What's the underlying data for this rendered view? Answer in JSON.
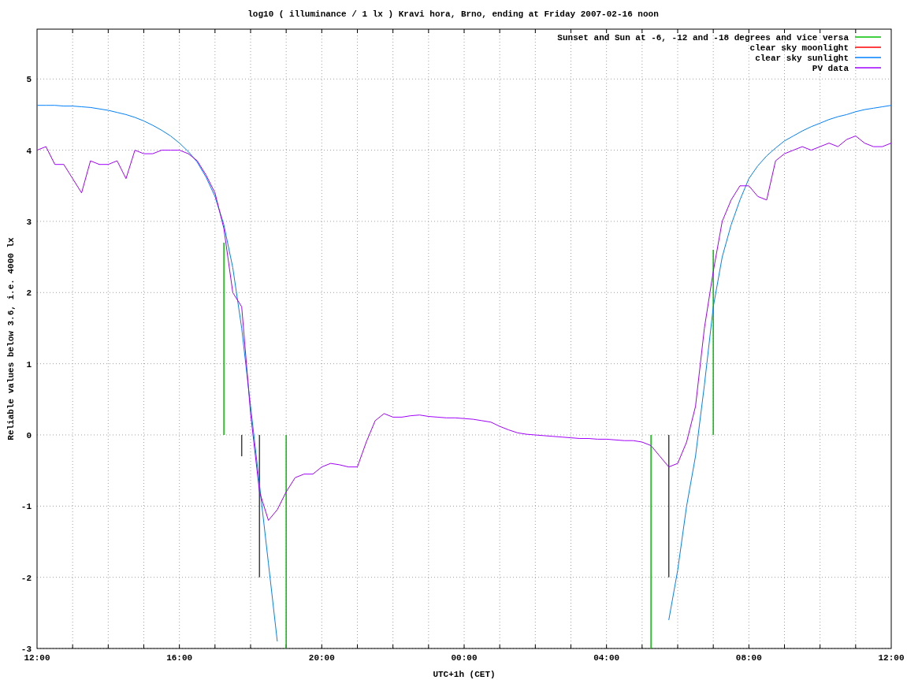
{
  "chart_data": {
    "type": "line",
    "title": "log10 ( illuminance / 1 lx ) Kravi hora, Brno, ending at Friday 2007-02-16 noon",
    "xlabel": "UTC+1h (CET)",
    "ylabel": "Reliable values below 3.6, i.e. 4000 lx",
    "ylim": [
      -3,
      5.7
    ],
    "yticks": [
      -3,
      -2,
      -1,
      0,
      1,
      2,
      3,
      4,
      5
    ],
    "categories": [
      "12:00",
      null,
      null,
      null,
      null,
      null,
      null,
      null,
      null,
      null,
      null,
      null,
      null,
      null,
      null,
      null,
      "16:00",
      null,
      null,
      null,
      null,
      null,
      null,
      null,
      null,
      null,
      null,
      null,
      null,
      null,
      null,
      null,
      "20:00",
      null,
      null,
      null,
      null,
      null,
      null,
      null,
      null,
      null,
      null,
      null,
      null,
      null,
      null,
      null,
      "00:00",
      null,
      null,
      null,
      null,
      null,
      null,
      null,
      null,
      null,
      null,
      null,
      null,
      null,
      null,
      null,
      "04:00",
      null,
      null,
      null,
      null,
      null,
      null,
      null,
      null,
      null,
      null,
      null,
      null,
      null,
      null,
      null,
      "08:00",
      null,
      null,
      null,
      null,
      null,
      null,
      null,
      null,
      null,
      null,
      null,
      null,
      null,
      null,
      null,
      "12:00"
    ],
    "series": [
      {
        "name": "Sunset and Sun at -6, -12 and -18 degrees and vice versa",
        "color": "#00c000",
        "type": "bar",
        "values": [
          null,
          null,
          null,
          null,
          null,
          null,
          null,
          null,
          null,
          null,
          null,
          null,
          null,
          null,
          null,
          null,
          null,
          null,
          null,
          null,
          null,
          2.7,
          null,
          null,
          null,
          null,
          null,
          null,
          -3,
          null,
          null,
          null,
          null,
          null,
          null,
          null,
          null,
          null,
          null,
          null,
          null,
          null,
          null,
          null,
          null,
          null,
          null,
          null,
          null,
          null,
          null,
          null,
          null,
          null,
          null,
          null,
          null,
          null,
          null,
          null,
          null,
          null,
          null,
          null,
          null,
          null,
          null,
          null,
          null,
          -3,
          null,
          null,
          null,
          null,
          null,
          null,
          2.6,
          null,
          null,
          null,
          null,
          null,
          null,
          null,
          null,
          null,
          null,
          null,
          null,
          null,
          null,
          null,
          null,
          null,
          null,
          null,
          null
        ]
      },
      {
        "name": "clear sky moonlight",
        "color": "#ff0000",
        "values": [
          null,
          null,
          null,
          null,
          null,
          null,
          null,
          null,
          null,
          null,
          null,
          null,
          null,
          null,
          null,
          null,
          null,
          null,
          null,
          null,
          null,
          null,
          null,
          null,
          null,
          null,
          null,
          null,
          null,
          null,
          null,
          null,
          null,
          null,
          null,
          null,
          null,
          null,
          null,
          null,
          null,
          null,
          null,
          null,
          null,
          null,
          null,
          null,
          null,
          null,
          null,
          null,
          null,
          null,
          null,
          null,
          null,
          null,
          null,
          null,
          null,
          null,
          null,
          null,
          null,
          null,
          null,
          null,
          null,
          null,
          null,
          null,
          null,
          null,
          null,
          null,
          null,
          null,
          null,
          null,
          null,
          null,
          null,
          null,
          null,
          null,
          null,
          null,
          null,
          null,
          null,
          null,
          null,
          null,
          null,
          null,
          null
        ]
      },
      {
        "name": "clear sky sunlight",
        "color": "#0080ff",
        "values": [
          4.63,
          4.63,
          4.63,
          4.62,
          4.62,
          4.61,
          4.6,
          4.58,
          4.56,
          4.53,
          4.5,
          4.46,
          4.41,
          4.35,
          4.28,
          4.2,
          4.1,
          3.98,
          3.83,
          3.62,
          3.35,
          2.95,
          2.35,
          1.5,
          0.4,
          -0.7,
          -1.8,
          -2.9,
          null,
          null,
          null,
          null,
          null,
          null,
          null,
          null,
          null,
          null,
          null,
          null,
          null,
          null,
          null,
          null,
          null,
          null,
          null,
          null,
          null,
          null,
          null,
          null,
          null,
          null,
          null,
          null,
          null,
          null,
          null,
          null,
          null,
          null,
          null,
          null,
          null,
          null,
          null,
          null,
          null,
          null,
          null,
          -2.6,
          -1.9,
          -1.0,
          -0.3,
          0.7,
          1.8,
          2.5,
          2.95,
          3.3,
          3.6,
          3.78,
          3.92,
          4.03,
          4.13,
          4.2,
          4.27,
          4.33,
          4.38,
          4.43,
          4.47,
          4.5,
          4.54,
          4.57,
          4.59,
          4.61,
          4.63
        ]
      },
      {
        "name": "PV data",
        "color": "#a000ff",
        "values": [
          4.0,
          4.05,
          3.8,
          3.8,
          3.6,
          3.4,
          3.85,
          3.8,
          3.8,
          3.85,
          3.6,
          4.0,
          3.95,
          3.95,
          4.0,
          4.0,
          4.0,
          3.95,
          3.85,
          3.65,
          3.4,
          2.9,
          2.0,
          1.8,
          0.3,
          -0.8,
          -1.2,
          -1.05,
          -0.8,
          -0.6,
          -0.55,
          -0.55,
          -0.45,
          -0.4,
          -0.42,
          -0.45,
          -0.45,
          -0.1,
          0.2,
          0.3,
          0.25,
          0.25,
          0.27,
          0.28,
          0.26,
          0.25,
          0.24,
          0.24,
          0.23,
          0.22,
          0.2,
          0.18,
          0.12,
          0.07,
          0.03,
          0.01,
          0.0,
          -0.01,
          -0.02,
          -0.03,
          -0.04,
          -0.05,
          -0.05,
          -0.06,
          -0.06,
          -0.07,
          -0.08,
          -0.08,
          -0.1,
          -0.15,
          -0.3,
          -0.45,
          -0.4,
          -0.1,
          0.4,
          1.5,
          2.3,
          3.0,
          3.3,
          3.5,
          3.5,
          3.35,
          3.3,
          3.85,
          3.95,
          4.0,
          4.05,
          4.0,
          4.05,
          4.1,
          4.05,
          4.15,
          4.2,
          4.1,
          4.05,
          4.05,
          4.1
        ]
      },
      {
        "color": "#404040",
        "type": "bar",
        "values": [
          null,
          null,
          null,
          null,
          null,
          null,
          null,
          null,
          null,
          null,
          null,
          null,
          null,
          null,
          null,
          null,
          null,
          null,
          null,
          null,
          null,
          null,
          null,
          -0.3,
          null,
          -2,
          null,
          null,
          null,
          null,
          null,
          null,
          null,
          null,
          null,
          null,
          null,
          null,
          null,
          null,
          null,
          null,
          null,
          null,
          null,
          null,
          null,
          null,
          null,
          null,
          null,
          null,
          null,
          null,
          null,
          null,
          null,
          null,
          null,
          null,
          null,
          null,
          null,
          null,
          null,
          null,
          null,
          null,
          null,
          null,
          null,
          -2,
          null,
          null,
          null,
          null,
          null,
          null,
          null,
          null,
          null,
          null,
          null,
          null,
          null,
          null,
          null,
          null,
          null,
          null,
          null,
          null,
          null,
          null,
          null,
          null,
          null
        ]
      }
    ],
    "grid": true,
    "legend": true
  }
}
